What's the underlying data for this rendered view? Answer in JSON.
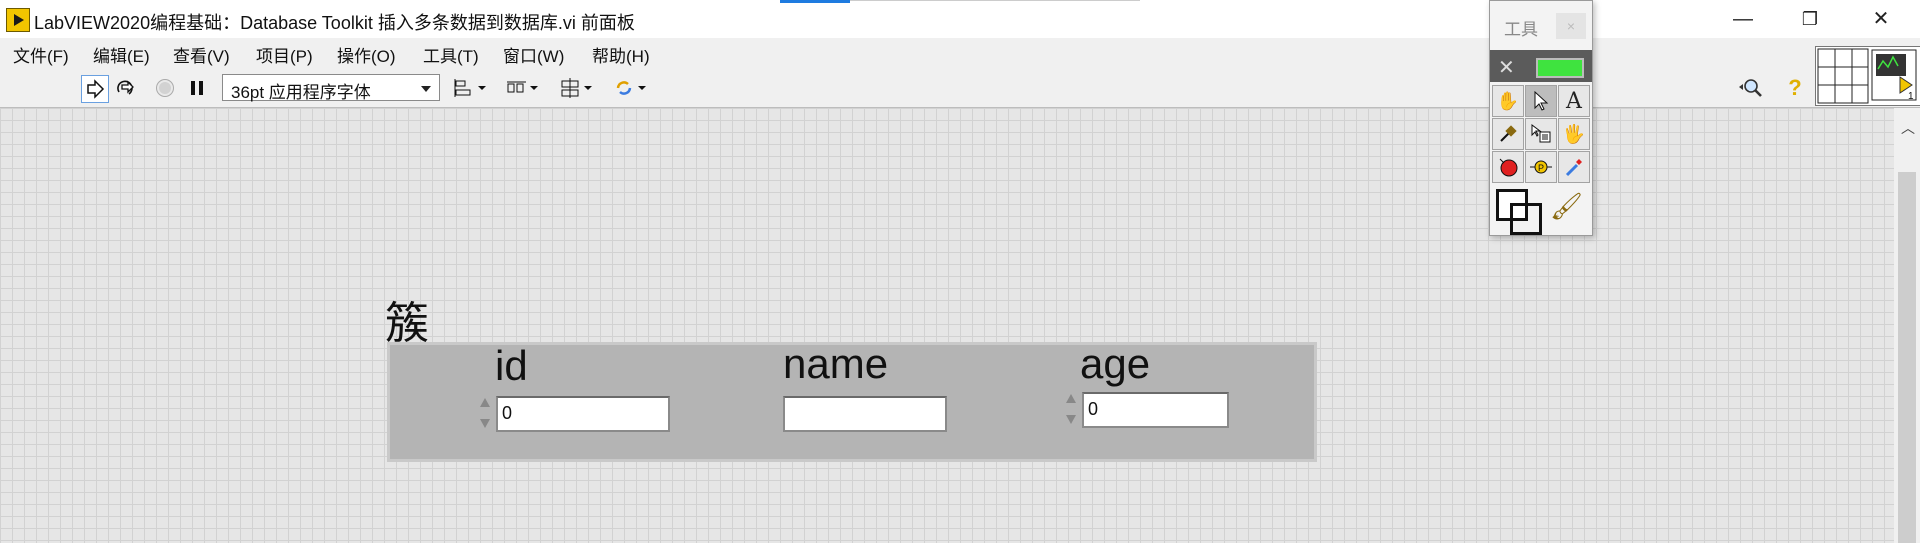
{
  "window": {
    "title": "LabVIEW2020编程基础：Database Toolkit 插入多条数据到数据库.vi 前面板",
    "minimize_glyph": "—",
    "restore_glyph": "❐",
    "close_glyph": "✕"
  },
  "menu": {
    "items": [
      "文件(F)",
      "编辑(E)",
      "查看(V)",
      "项目(P)",
      "操作(O)",
      "工具(T)",
      "窗口(W)",
      "帮助(H)"
    ]
  },
  "toolbar": {
    "run_icon": "run-arrow-icon",
    "run_continuous_icon": "run-continuously-icon",
    "abort_icon": "abort-icon",
    "pause_icon": "pause-icon",
    "font_value": "36pt 应用程序字体",
    "align_icon": "align-objects-icon",
    "distribute_icon": "distribute-objects-icon",
    "resize_icon": "resize-objects-icon",
    "reorder_icon": "reorder-icon",
    "search_icon": "search-icon",
    "help_icon": "help-icon"
  },
  "tools_palette": {
    "title": "工具",
    "close_glyph": "×",
    "colors": {
      "led": "#3fe33f",
      "header": "#5b5b5b"
    }
  },
  "front_panel": {
    "cluster_label": "簇",
    "fields": {
      "id": {
        "label": "id",
        "value": "0"
      },
      "name": {
        "label": "name",
        "value": ""
      },
      "age": {
        "label": "age",
        "value": "0"
      }
    },
    "colors": {
      "cluster_bg": "#b4b4b4",
      "grid_bg": "#e6e6e6"
    }
  }
}
